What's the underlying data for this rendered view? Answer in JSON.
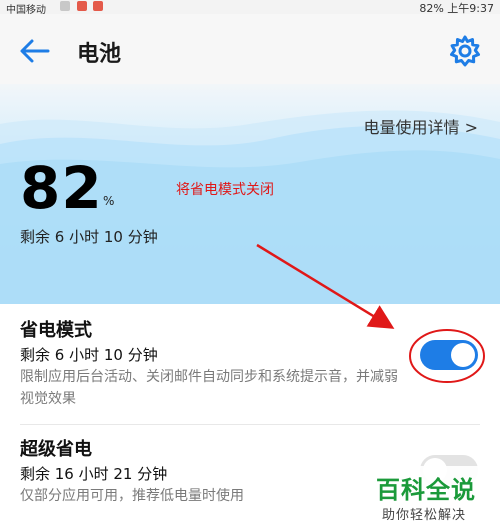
{
  "status_bar": {
    "carrier": "中国移动",
    "right_text": "82%  上午9:37"
  },
  "header": {
    "title": "电池",
    "back_icon": "arrow-left-icon",
    "settings_icon": "gear-icon"
  },
  "hero": {
    "details_link": "电量使用详情 >",
    "percent": "82",
    "percent_unit": "%",
    "remaining": "剩余 6 小时 10 分钟",
    "annotation": "将省电模式关闭",
    "accent_color": "#1e7de6",
    "annotation_color": "#e01818"
  },
  "power_saving": {
    "label": "省电模式",
    "remaining": "剩余 6 小时 10 分钟",
    "description": "限制应用后台活动、关闭邮件自动同步和系统提示音，并减弱视觉效果",
    "enabled": true
  },
  "ultra_saving": {
    "label": "超级省电",
    "remaining": "剩余 16 小时 21 分钟",
    "description": "仅部分应用可用，推荐低电量时使用",
    "enabled": false
  },
  "watermark": {
    "main": "百科全说",
    "sub": "助你轻松解决"
  }
}
